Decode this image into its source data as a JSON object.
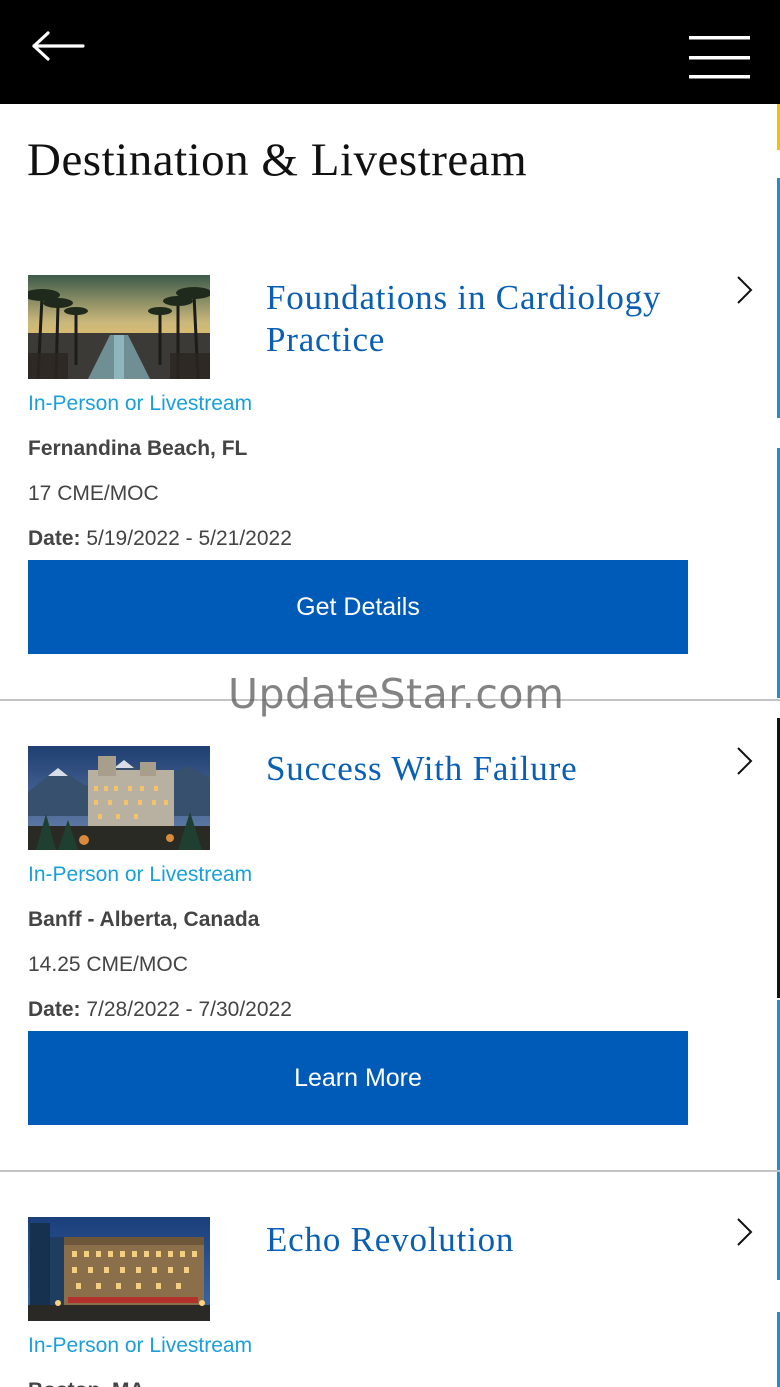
{
  "header": {
    "back_icon": "back-arrow-icon",
    "menu_icon": "hamburger-menu-icon"
  },
  "page": {
    "title": "Destination & Livestream"
  },
  "courses": [
    {
      "title": "Foundations in Cardiology Practice",
      "mode": "In-Person or Livestream",
      "location": "Fernandina Beach, FL",
      "credits": "17 CME/MOC",
      "date_label": "Date:",
      "date": "5/19/2022 - 5/21/2022",
      "button": "Get Details"
    },
    {
      "title": "Success With Failure",
      "mode": "In-Person or Livestream",
      "location": "Banff - Alberta, Canada",
      "credits": "14.25 CME/MOC",
      "date_label": "Date:",
      "date": "7/28/2022 - 7/30/2022",
      "button": "Learn More"
    },
    {
      "title": "Echo Revolution",
      "mode": "In-Person or Livestream",
      "location": "Boston, MA"
    }
  ],
  "watermark": "UpdateStar.com",
  "colors": {
    "header_bg": "#000000",
    "title_blue": "#0a5fb4",
    "mode_blue": "#1a9fd8",
    "button_blue": "#005bb8",
    "text_gray": "#444444"
  }
}
